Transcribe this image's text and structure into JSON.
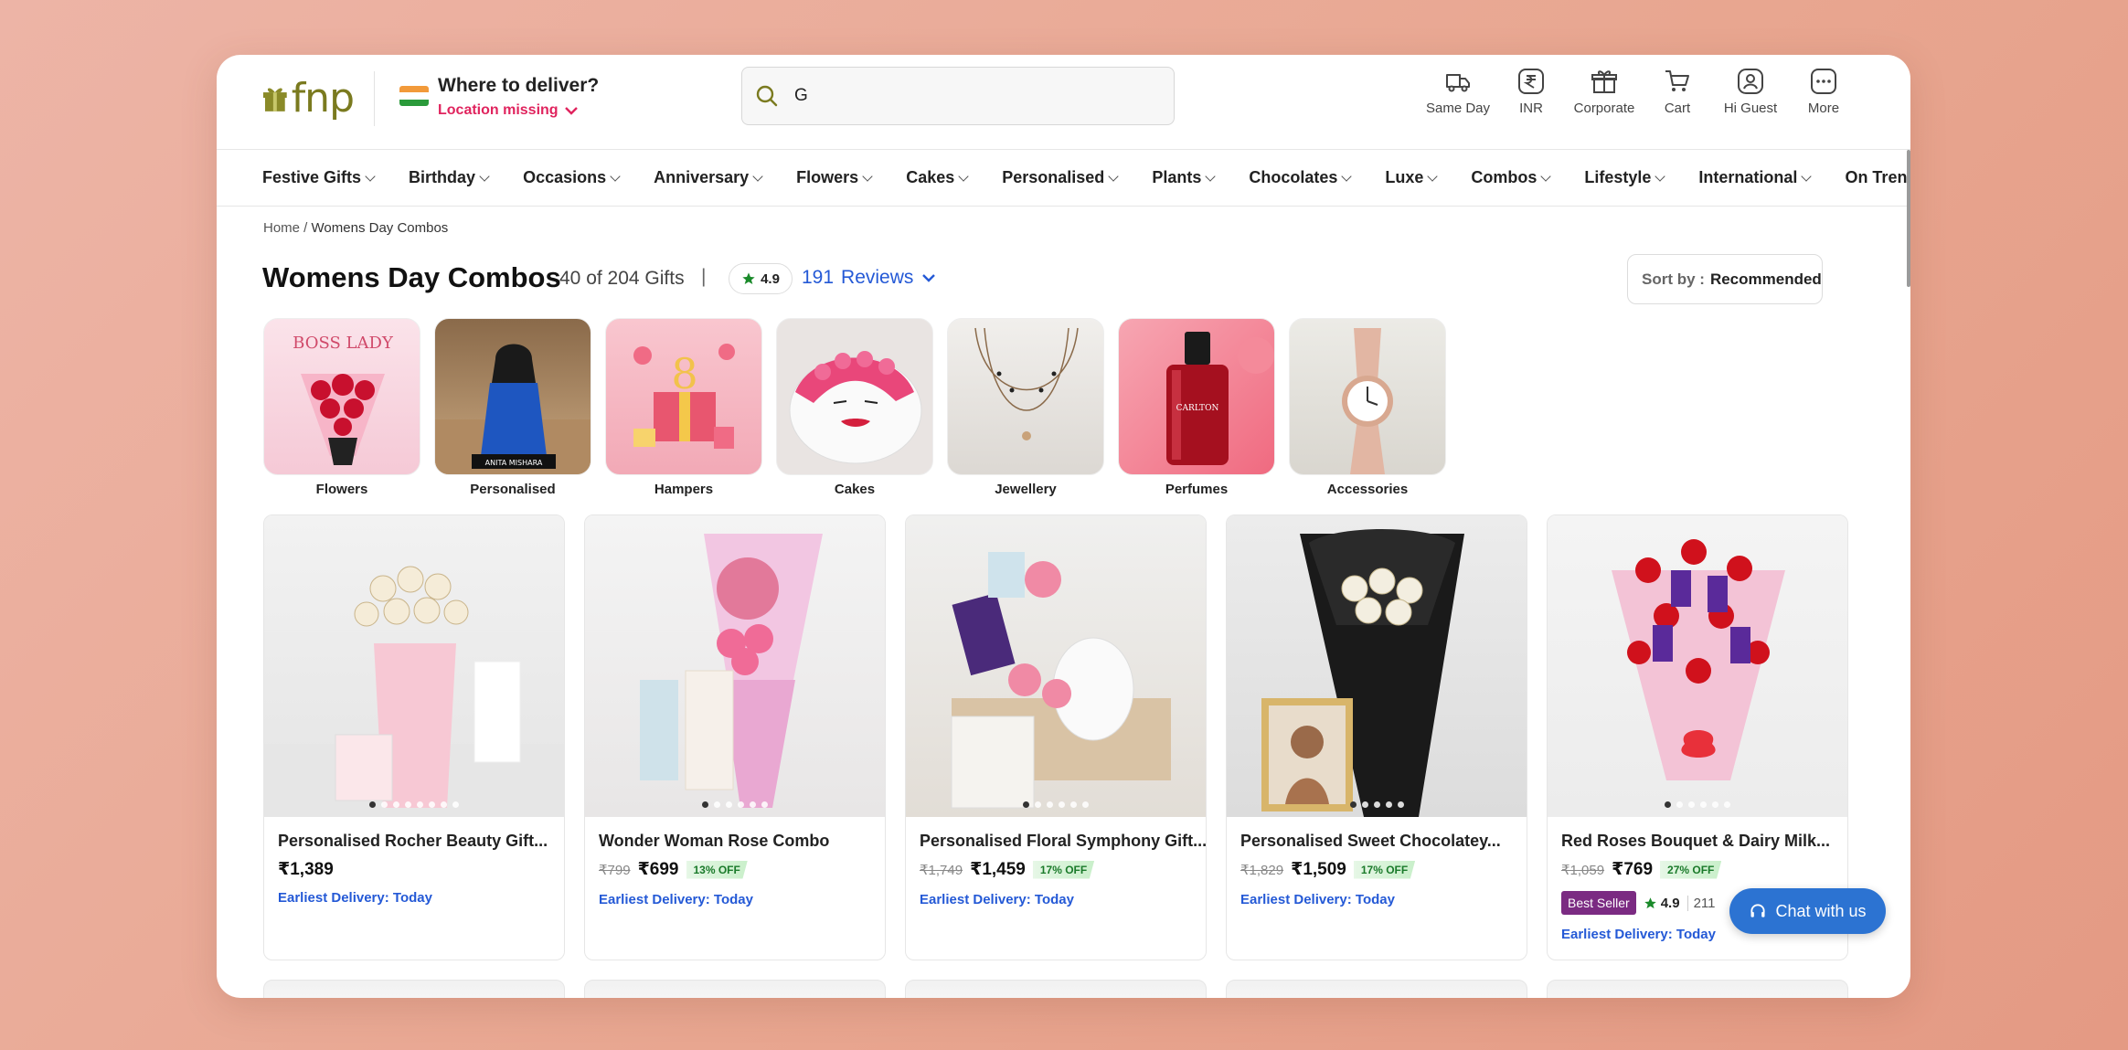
{
  "header": {
    "logo_text": "fnp",
    "deliver_title": "Where to deliver?",
    "deliver_sub": "Location missing",
    "search_value": "G",
    "tools": [
      {
        "label": "Same Day",
        "icon": "truck-icon"
      },
      {
        "label": "INR",
        "icon": "rupee-icon"
      },
      {
        "label": "Corporate",
        "icon": "gift-box-icon"
      },
      {
        "label": "Cart",
        "icon": "cart-icon"
      },
      {
        "label": "Hi Guest",
        "icon": "user-icon"
      },
      {
        "label": "More",
        "icon": "more-icon"
      }
    ]
  },
  "nav": [
    "Festive Gifts",
    "Birthday",
    "Occasions",
    "Anniversary",
    "Flowers",
    "Cakes",
    "Personalised",
    "Plants",
    "Chocolates",
    "Luxe",
    "Combos",
    "Lifestyle",
    "International",
    "On Trend"
  ],
  "breadcrumb": {
    "home": "Home",
    "separator": " / ",
    "current": "Womens Day Combos"
  },
  "page": {
    "title": "Womens Day Combos",
    "count": "40 of 204 Gifts",
    "separator": "|",
    "rating": "4.9",
    "reviews_count": "191",
    "reviews_label": "Reviews",
    "sort_label": "Sort by :",
    "sort_value": "Recommended"
  },
  "categories": [
    "Flowers",
    "Personalised",
    "Hampers",
    "Cakes",
    "Jewellery",
    "Perfumes",
    "Accessories"
  ],
  "category_image_text": {
    "boss_lady": "BOSS LADY",
    "name_tag": "ANITA MISHARA",
    "perfume_brand": "CARLTON"
  },
  "products": [
    {
      "name": "Personalised Rocher Beauty Gift...",
      "mrp": "",
      "price": "₹1,389",
      "off": "",
      "delivery": "Earliest Delivery: Today"
    },
    {
      "name": "Wonder Woman Rose Combo",
      "mrp": "₹799",
      "price": "₹699",
      "off": "13% OFF",
      "delivery": "Earliest Delivery: Today"
    },
    {
      "name": "Personalised Floral Symphony Gift...",
      "mrp": "₹1,749",
      "price": "₹1,459",
      "off": "17% OFF",
      "delivery": "Earliest Delivery: Today"
    },
    {
      "name": "Personalised Sweet Chocolatey...",
      "mrp": "₹1,829",
      "price": "₹1,509",
      "off": "17% OFF",
      "delivery": "Earliest Delivery: Today"
    },
    {
      "name": "Red Roses Bouquet & Dairy Milk...",
      "mrp": "₹1,059",
      "price": "₹769",
      "off": "27% OFF",
      "delivery": "Earliest Delivery: Today",
      "badge": "Best Seller",
      "rating": "4.9",
      "rating_count": "211"
    }
  ],
  "chat": {
    "label": "Chat with us"
  },
  "colors": {
    "accent_pink": "#e0245e",
    "link_blue": "#2459d6",
    "chat_blue": "#2c73d2",
    "badge_purple": "#7b2b82",
    "logo_olive": "#7a7a1f",
    "star_green": "#1a8a2a"
  }
}
